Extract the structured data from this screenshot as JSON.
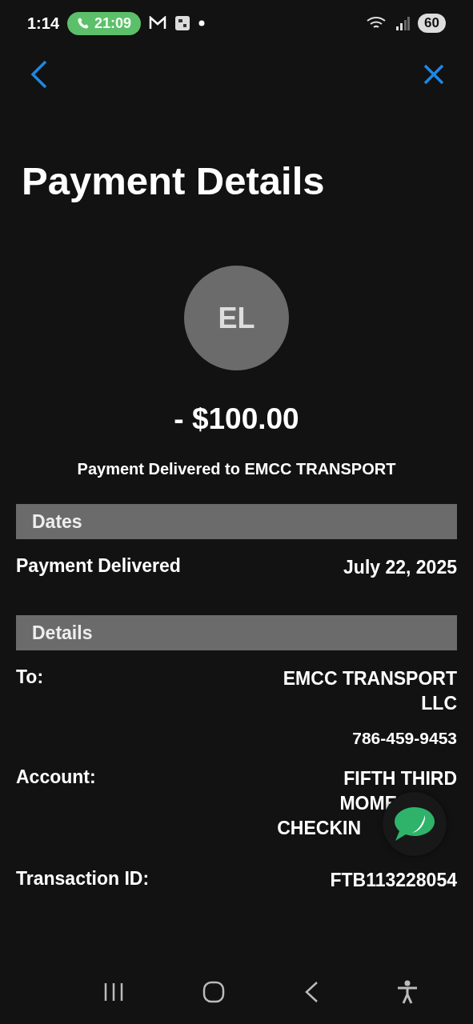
{
  "status_bar": {
    "time": "1:14",
    "call_timer": "21:09",
    "battery": "60"
  },
  "title": "Payment Details",
  "payee": {
    "initials": "EL",
    "amount": "- $100.00",
    "summary": "Payment Delivered to EMCC TRANSPORT"
  },
  "sections": [
    {
      "heading": "Dates",
      "rows": [
        {
          "label": "Payment Delivered",
          "values": [
            "July 22, 2025"
          ]
        }
      ]
    },
    {
      "heading": "Details",
      "rows": [
        {
          "label": "To:",
          "values": [
            "EMCC TRANSPORT LLC",
            "786-459-9453"
          ]
        },
        {
          "label": "Account:",
          "kind": "covered",
          "values": [
            "FIFTH THIRD",
            "MOME",
            "CHECKIN"
          ]
        },
        {
          "label": "Transaction ID:",
          "values": [
            "FTB113228054"
          ]
        }
      ]
    }
  ]
}
